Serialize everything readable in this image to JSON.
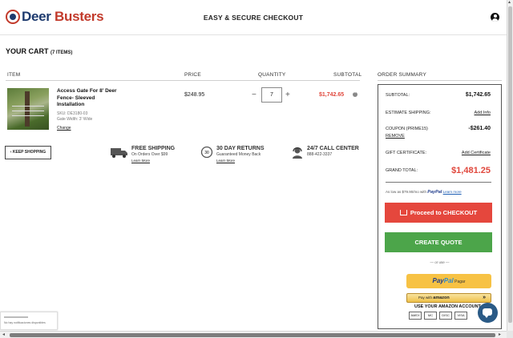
{
  "header": {
    "logo_prefix": "Deer",
    "logo_suffix": "Busters",
    "title": "EASY & SECURE CHECKOUT"
  },
  "cart": {
    "title": "YOUR CART",
    "count_label": "(7 ITEMS)",
    "columns": {
      "item": "ITEM",
      "price": "PRICE",
      "quantity": "QUANTITY",
      "subtotal": "SUBTOTAL"
    },
    "items": [
      {
        "name": "Access Gate For 8' Deer Fence- Sleeved Installation",
        "sku": "SKU: DE3180-03",
        "variant": "Gate Width: 3' Wide",
        "change_label": "Change",
        "price": "$248.95",
        "quantity": "7",
        "subtotal": "$1,742.65"
      }
    ],
    "keep_shopping_label": "KEEP SHOPPING"
  },
  "perks": [
    {
      "title": "FREE SHIPPING",
      "subtitle": "On Orders Over $99",
      "link": "Learn More",
      "icon": "truck-icon"
    },
    {
      "title": "30 DAY RETURNS",
      "subtitle": "Guaranteed Money Back",
      "link": "Learn More",
      "icon": "returns-icon"
    },
    {
      "title": "24/7 CALL CENTER",
      "subtitle": "888-422-3337",
      "link": "",
      "icon": "call-center-icon"
    }
  ],
  "summary": {
    "heading": "ORDER SUMMARY",
    "subtotal_label": "SUBTOTAL:",
    "subtotal_value": "$1,742.65",
    "shipping_label": "ESTIMATE SHIPPING:",
    "shipping_link": "Add Info",
    "coupon_label": "COUPON (PRIME15)",
    "coupon_value": "-$261.40",
    "coupon_remove": "REMOVE",
    "gift_label": "GIFT CERTIFICATE:",
    "gift_link": "Add Certificate",
    "total_label": "GRAND TOTAL:",
    "total_value": "$1,481.25",
    "paypal_prefix": "As low as $79.90/mo with",
    "paypal_brand": "PayPal",
    "paypal_learn": "Learn more",
    "checkout_label": "Proceed to CHECKOUT",
    "quote_label": "CREATE QUOTE",
    "or_use": "— or use —",
    "paypal_btn_brand_1": "Pay",
    "paypal_btn_brand_2": "Pal",
    "paypal_btn_text": "Pagar",
    "amazon_prefix": "Pay with",
    "amazon_brand": "amazon",
    "amazon_note": "USE YOUR AMAZON ACCOUNT",
    "cards": [
      "AMEX",
      "MC",
      "DISC",
      "VISA"
    ]
  },
  "notice": {
    "text": "No hay notificaciones disponibles"
  },
  "colors": {
    "brand_red": "#c23a2b",
    "brand_navy": "#1d3a6e",
    "price_red": "#e0473c",
    "checkout_red": "#e5473d",
    "quote_green": "#4ca54a",
    "paypal_yellow": "#f7c244"
  }
}
